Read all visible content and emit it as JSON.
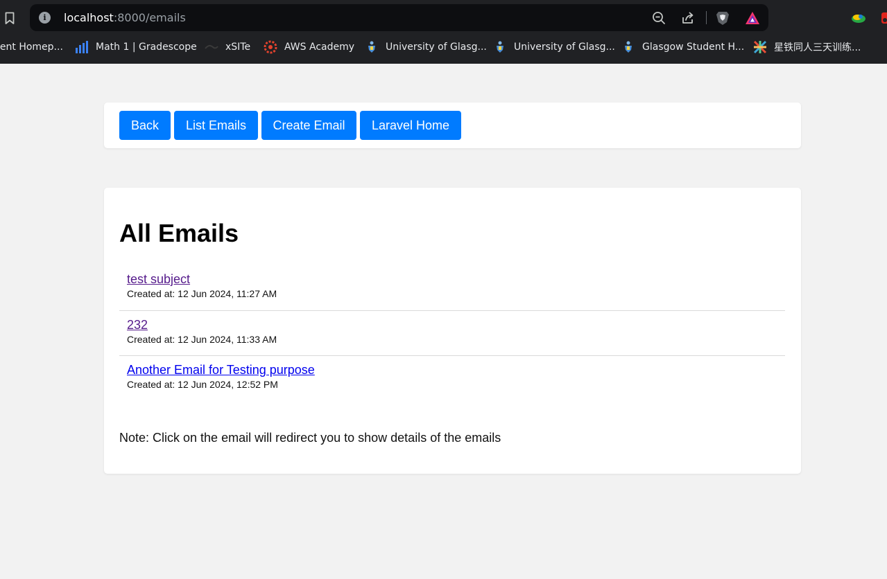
{
  "browser": {
    "url_host": "localhost",
    "url_path": ":8000/emails",
    "bookmarks": [
      {
        "label": "lent Homep...",
        "icon": "none"
      },
      {
        "label": "Math 1 | Gradescope",
        "icon": "gradescope-icon"
      },
      {
        "label": "xSITe",
        "icon": "xsite-icon"
      },
      {
        "label": "AWS Academy",
        "icon": "aws-academy-icon"
      },
      {
        "label": "University of Glasg...",
        "icon": "university-crest-icon"
      },
      {
        "label": "University of Glasg...",
        "icon": "university-crest-icon"
      },
      {
        "label": "Glasgow Student H...",
        "icon": "university-crest-icon"
      },
      {
        "label": "星铁同人三天训练...",
        "icon": "colorful-site-icon"
      }
    ]
  },
  "nav": {
    "back": "Back",
    "list_emails": "List Emails",
    "create_email": "Create Email",
    "laravel_home": "Laravel Home"
  },
  "main": {
    "title": "All Emails",
    "emails": [
      {
        "subject": "test subject",
        "created": "Created at: 12 Jun 2024, 11:27 AM",
        "visited": true
      },
      {
        "subject": "232",
        "created": "Created at: 12 Jun 2024, 11:33 AM",
        "visited": true
      },
      {
        "subject": "Another Email for Testing purpose",
        "created": "Created at: 12 Jun 2024, 12:52 PM",
        "visited": false
      }
    ],
    "note": "Note: Click on the email will redirect you to show details of the emails"
  },
  "colors": {
    "primary_button": "#007bff",
    "visited_link": "#551a8b",
    "link": "#0000ee",
    "page_bg": "#f2f2f2",
    "chrome_bg": "#202124"
  }
}
